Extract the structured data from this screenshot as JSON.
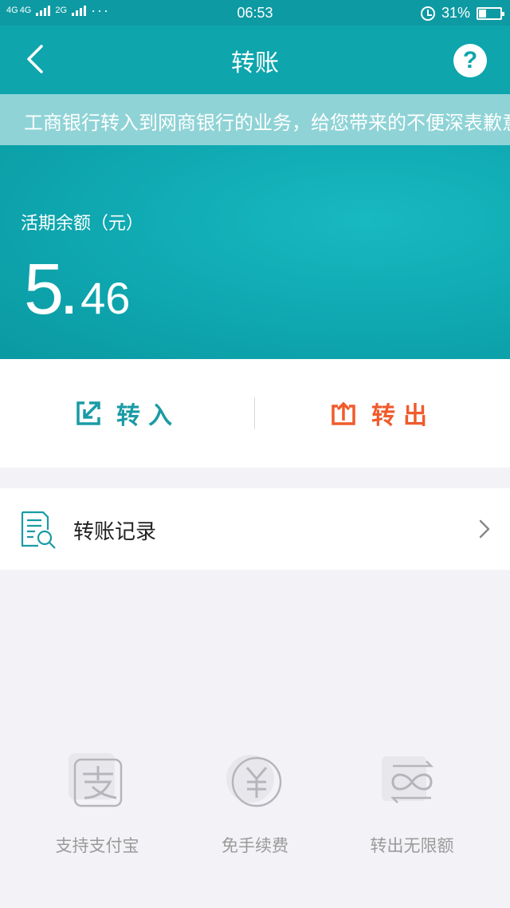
{
  "status_bar": {
    "network_1": "4G",
    "network_2": "4G",
    "network_3": "2G",
    "more": "···",
    "time": "06:53",
    "battery": "31%",
    "battery_level": 0.31
  },
  "header": {
    "title": "转账"
  },
  "notice": {
    "text": "工商银行转入到网商银行的业务，给您带来的不便深表歉意"
  },
  "balance": {
    "label": "活期余额（元）",
    "integer": "5",
    "dot": ".",
    "decimal": "46"
  },
  "actions": {
    "transfer_in": "转入",
    "transfer_out": "转出"
  },
  "records": {
    "label": "转账记录"
  },
  "features": [
    {
      "label": "支持支付宝",
      "icon": "alipay-icon"
    },
    {
      "label": "免手续费",
      "icon": "yuan-icon"
    },
    {
      "label": "转出无限额",
      "icon": "infinity-icon"
    }
  ],
  "colors": {
    "primary": "#0ea5ad",
    "notice_bg": "#8fd3d6",
    "transfer_in": "#1a9ba5",
    "transfer_out": "#f05b2c"
  }
}
